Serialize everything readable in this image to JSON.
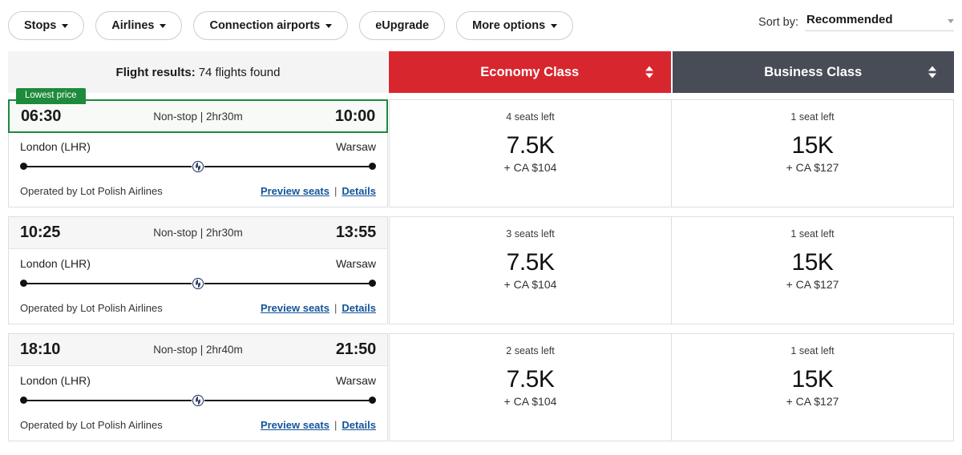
{
  "filters": [
    {
      "label": "Stops",
      "has_caret": true
    },
    {
      "label": "Airlines",
      "has_caret": true
    },
    {
      "label": "Connection airports",
      "has_caret": true
    },
    {
      "label": "eUpgrade",
      "has_caret": false
    },
    {
      "label": "More options",
      "has_caret": true
    }
  ],
  "sort": {
    "label": "Sort by:",
    "value": "Recommended"
  },
  "header": {
    "results_label": "Flight results:",
    "results_count": "74 flights found",
    "economy": "Economy Class",
    "business": "Business Class"
  },
  "colors": {
    "economy_header": "#d8262f",
    "business_header": "#474c57",
    "lowest_price_badge": "#1e8a3c",
    "link": "#14539a"
  },
  "flights": [
    {
      "badge": "Lowest price",
      "lowest": true,
      "depart_time": "06:30",
      "arrive_time": "10:00",
      "stops_duration": "Non-stop | 2hr30m",
      "origin": "London (LHR)",
      "destination": "Warsaw",
      "operator": "Operated by Lot Polish Airlines",
      "preview_seats": "Preview seats",
      "separator": "|",
      "details": "Details",
      "economy": {
        "seats": "4 seats left",
        "points": "7.5K",
        "cash": "+ CA $104"
      },
      "business": {
        "seats": "1 seat left",
        "points": "15K",
        "cash": "+ CA $127"
      }
    },
    {
      "badge": "",
      "lowest": false,
      "depart_time": "10:25",
      "arrive_time": "13:55",
      "stops_duration": "Non-stop | 2hr30m",
      "origin": "London (LHR)",
      "destination": "Warsaw",
      "operator": "Operated by Lot Polish Airlines",
      "preview_seats": "Preview seats",
      "separator": "|",
      "details": "Details",
      "economy": {
        "seats": "3 seats left",
        "points": "7.5K",
        "cash": "+ CA $104"
      },
      "business": {
        "seats": "1 seat left",
        "points": "15K",
        "cash": "+ CA $127"
      }
    },
    {
      "badge": "",
      "lowest": false,
      "depart_time": "18:10",
      "arrive_time": "21:50",
      "stops_duration": "Non-stop | 2hr40m",
      "origin": "London (LHR)",
      "destination": "Warsaw",
      "operator": "Operated by Lot Polish Airlines",
      "preview_seats": "Preview seats",
      "separator": "|",
      "details": "Details",
      "economy": {
        "seats": "2 seats left",
        "points": "7.5K",
        "cash": "+ CA $104"
      },
      "business": {
        "seats": "1 seat left",
        "points": "15K",
        "cash": "+ CA $127"
      }
    }
  ]
}
